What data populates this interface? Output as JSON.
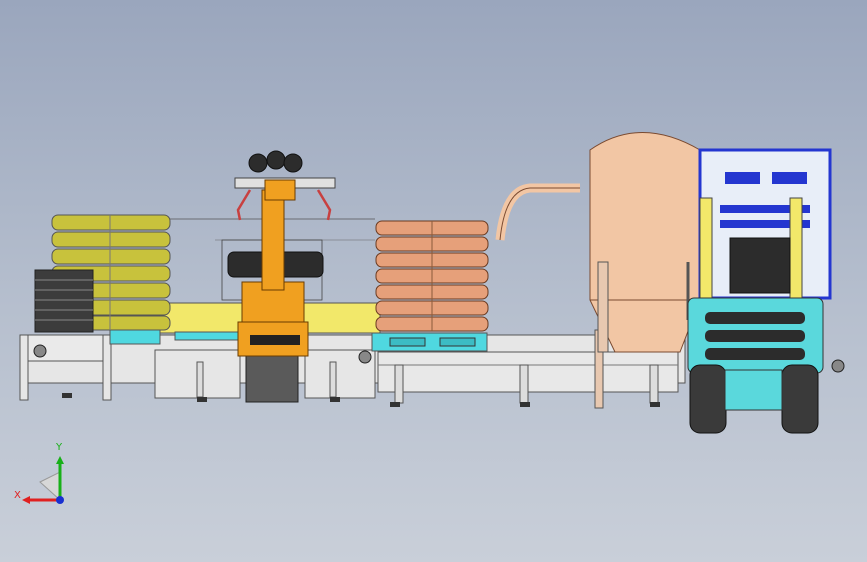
{
  "window": {
    "title": ""
  },
  "viewport": {
    "background_top": "#9aa6bd",
    "background_bottom": "#c9cfd9"
  },
  "triad": {
    "x_label": "X",
    "y_label": "Y",
    "x_color": "#e02020",
    "y_color": "#18b018",
    "z_color": "#1830d0"
  },
  "colors": {
    "conveyor": "#e6e6e6",
    "conveyor_edge": "#555555",
    "cyan_frame": "#4fd8e0",
    "yellow_plate": "#f2e86a",
    "robot_orange": "#f0a020",
    "bag_olive": "#c8c23c",
    "bag_copper": "#e6a07a",
    "tank_peach": "#f2c6a4",
    "forklift_cyan": "#5ad8dc",
    "forklift_blue": "#2436d0",
    "tire": "#3a3a3a",
    "pallet_dark": "#3c3c3c"
  },
  "scene_icon_names": [
    "conveyor-line-icon",
    "palletizing-robot-icon",
    "bag-stack-left-icon",
    "bag-stack-center-icon",
    "storage-silo-icon",
    "forklift-icon",
    "axis-triad-icon"
  ]
}
